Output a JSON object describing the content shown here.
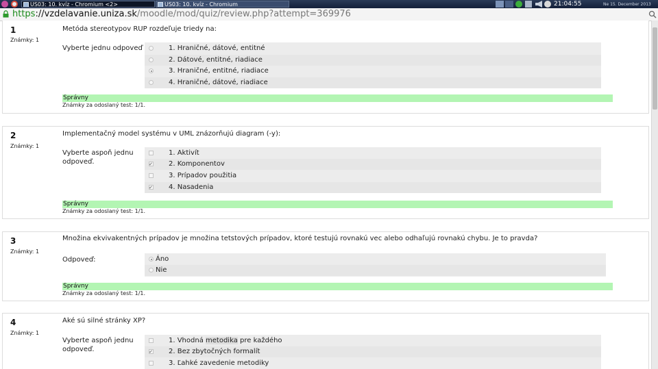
{
  "taskbar": {
    "tasks": [
      {
        "label": "US03: 10. kvíz - Chromium <2>",
        "active": true
      },
      {
        "label": "US03: 10. kvíz - Chromium",
        "active": false
      }
    ],
    "clock": "21:04:55",
    "date": "Ne 15. December 2013"
  },
  "browser": {
    "url_scheme": "https",
    "url_host": "://vzdelavanie.uniza.sk",
    "url_path": "/moodle/mod/quiz/review.php?attempt=369976"
  },
  "questions": [
    {
      "number": "1",
      "grade": "Známky: 1",
      "text": "Metóda stereotypov RUP rozdeľuje triedy na:",
      "prompt": "Vyberte jednu odpoveď",
      "type": "radio",
      "options": [
        {
          "label": "1. Hraničné, dátové, entitné",
          "selected": false
        },
        {
          "label": "2. Dátové, entitné, riadiace",
          "selected": false
        },
        {
          "label": "3. Hraničné, entitné, riadiace",
          "selected": true
        },
        {
          "label": "4. Hraničné, dátové, riadiace",
          "selected": false
        }
      ],
      "feedback": "Správny",
      "note": "Známky za odoslaný test: 1/1."
    },
    {
      "number": "2",
      "grade": "Známky: 1",
      "text": "Implementačný model systému v UML znázorňujú diagram (-y):",
      "prompt": "Vyberte aspoň jednu odpoveď.",
      "type": "checkbox",
      "options": [
        {
          "label": "1. Aktivít",
          "selected": false
        },
        {
          "label": "2. Komponentov",
          "selected": true
        },
        {
          "label": "3. Prípadov použitia",
          "selected": false
        },
        {
          "label": "4. Nasadenia",
          "selected": true
        }
      ],
      "feedback": "Správny",
      "note": "Známky za odoslaný test: 1/1."
    },
    {
      "number": "3",
      "grade": "Známky: 1",
      "text": "Množina ekvivakentných prípadov je množina tetstových prípadov, ktoré testujú rovnakú vec alebo odhaľujú rovnakú chybu. Je to pravda?",
      "prompt": "Odpoveď:",
      "type": "radio",
      "options": [
        {
          "label": "Áno",
          "selected": true
        },
        {
          "label": "Nie",
          "selected": false
        }
      ],
      "feedback": "Správny",
      "note": "Známky za odoslaný test: 1/1."
    },
    {
      "number": "4",
      "grade": "Známky: 1",
      "text": "Aké sú silné stránky XP?",
      "prompt": "Vyberte aspoň jednu odpoveď.",
      "type": "checkbox",
      "options": [
        {
          "label_parts": [
            "1. Vhodná ",
            "metodika",
            " pre každého"
          ],
          "selected": false
        },
        {
          "label": "2. Bez zbytočných formalít",
          "selected": true
        },
        {
          "label": "3. Ľahké zavedenie metodiky",
          "selected": false
        }
      ]
    }
  ]
}
